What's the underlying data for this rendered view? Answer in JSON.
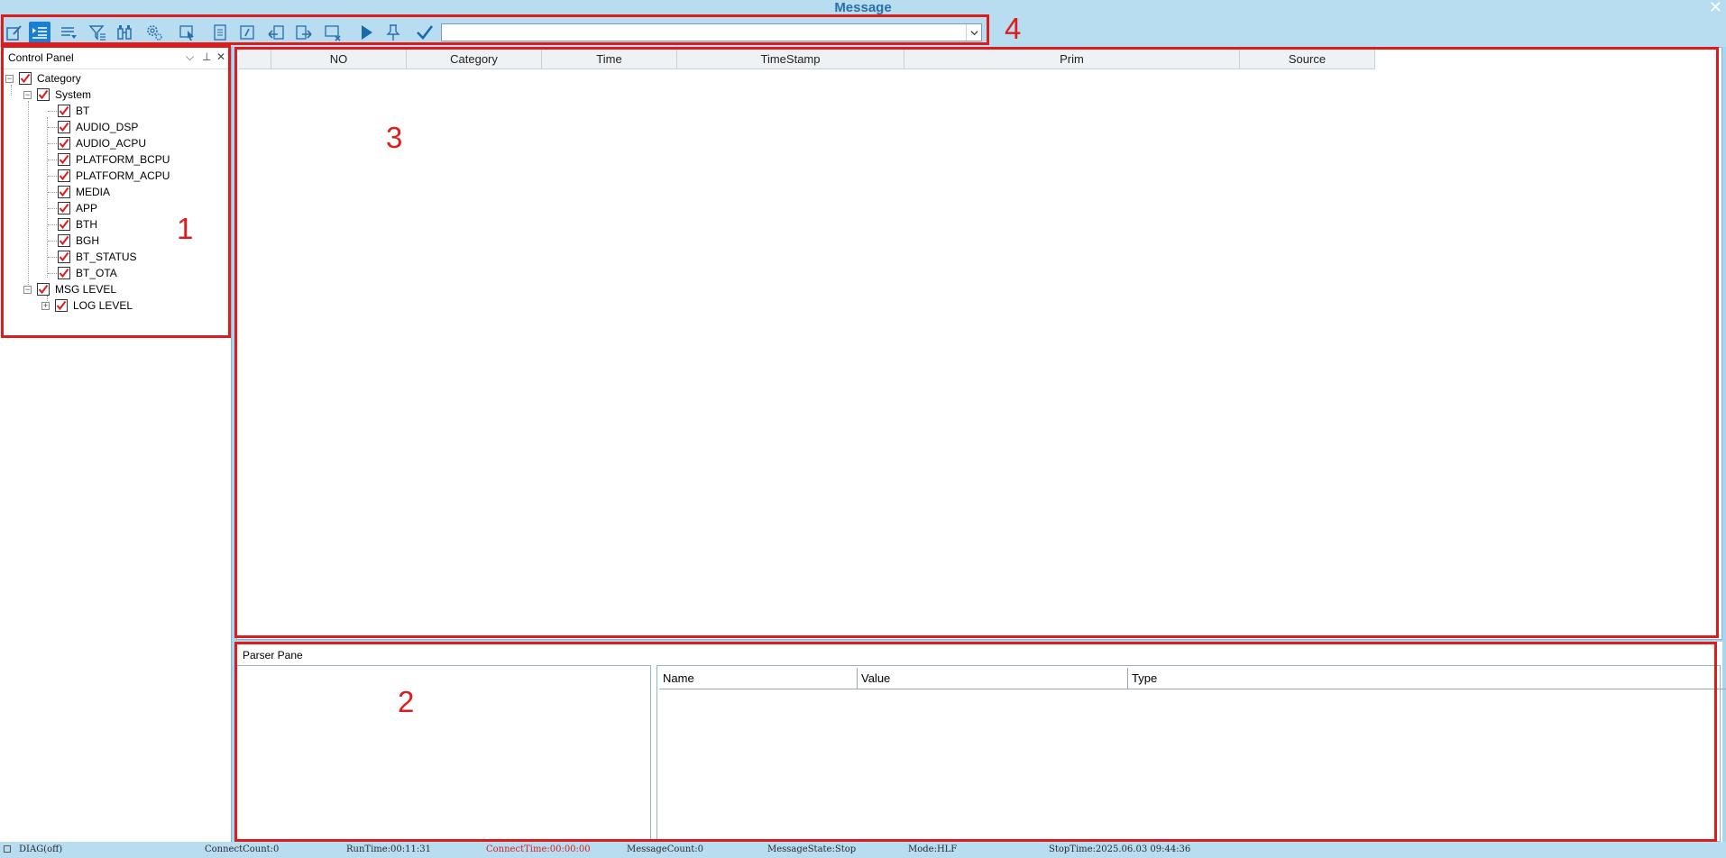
{
  "window": {
    "title": "Message",
    "close_glyph": "✕"
  },
  "toolbar": {
    "buttons": [
      {
        "icon": "edit-icon",
        "active": false
      },
      {
        "icon": "list-indent-icon",
        "active": true
      },
      {
        "icon": "list-dropdown-icon",
        "active": false
      },
      {
        "icon": "filter-icon",
        "active": false
      },
      {
        "icon": "binoculars-icon",
        "active": false
      },
      {
        "icon": "gear-icon",
        "active": false
      },
      {
        "icon": "select-cursor-icon",
        "active": false
      },
      {
        "icon": "document-icon",
        "active": false
      },
      {
        "icon": "note-icon",
        "active": false
      },
      {
        "icon": "import-icon",
        "active": false
      },
      {
        "icon": "export-icon",
        "active": false
      },
      {
        "icon": "clear-screen-icon",
        "active": false
      },
      {
        "icon": "play-icon",
        "active": false
      },
      {
        "icon": "pin-icon",
        "active": false
      },
      {
        "icon": "checkmark-icon",
        "active": false
      }
    ],
    "combo_value": ""
  },
  "control_panel": {
    "title": "Control Panel",
    "dropdown_glyph": "⌵",
    "pin_glyph": "⊥",
    "close_glyph": "✕",
    "tree": {
      "root": {
        "label": "Category",
        "expanded": true,
        "checked": true
      },
      "system": {
        "label": "System",
        "expanded": true,
        "checked": true
      },
      "system_items": [
        "BT",
        "AUDIO_DSP",
        "AUDIO_ACPU",
        "PLATFORM_BCPU",
        "PLATFORM_ACPU",
        "MEDIA",
        "APP",
        "BTH",
        "BGH",
        "BT_STATUS",
        "BT_OTA"
      ],
      "msg_level": {
        "label": "MSG LEVEL",
        "expanded": true,
        "checked": true
      },
      "log_level": {
        "label": "LOG LEVEL",
        "expanded": false,
        "checked": true
      }
    }
  },
  "message_table": {
    "columns": [
      "",
      "NO",
      "Category",
      "Time",
      "TimeStamp",
      "Prim",
      "Source"
    ],
    "rows": []
  },
  "parser_pane": {
    "title": "Parser Pane",
    "columns": [
      "Name",
      "Value",
      "Type"
    ]
  },
  "annotations": [
    "1",
    "2",
    "3",
    "4"
  ],
  "statusbar": {
    "diag": "DIAG(off)",
    "connect_count": "ConnectCount:0",
    "run_time": "RunTime:00:11:31",
    "connect_time": "ConnectTime:00:00:00",
    "message_count": "MessageCount:0",
    "message_state": "MessageState:Stop",
    "mode": "Mode:HLF",
    "stop_time": "StopTime:2025.06.03 09:44:36"
  },
  "colors": {
    "accent": "#1a7fd0",
    "annotation_red": "#e01b1b",
    "status_red": "#e01b1b",
    "chrome": "#b8dcf0"
  }
}
